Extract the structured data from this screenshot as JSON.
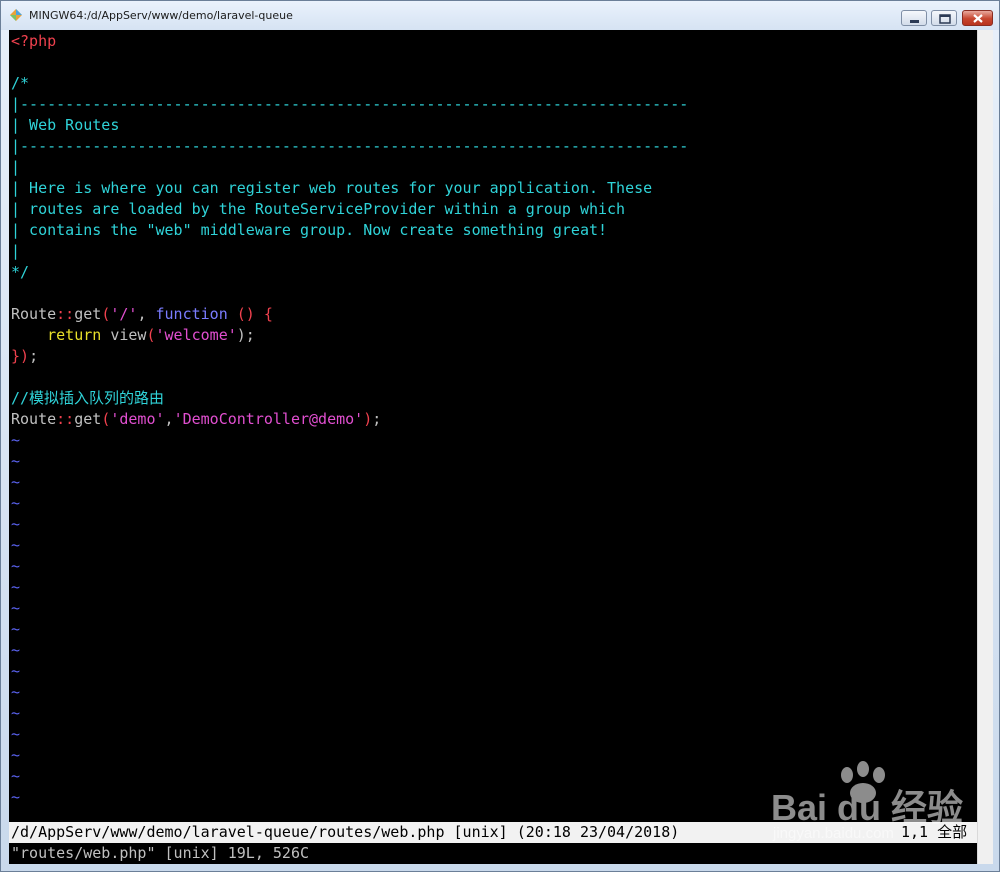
{
  "window": {
    "title": "MINGW64:/d/AppServ/www/demo/laravel-queue"
  },
  "colors": {
    "comment": "#2fd3d8",
    "red": "#f0414e",
    "string": "#e14fd0",
    "keyword": "#7a7cff",
    "plain": "#c0c0c0",
    "yellow": "#e8e02a",
    "tilde": "#5b63f2"
  },
  "editor": {
    "lines": [
      [
        {
          "t": "<?php",
          "c": "red"
        }
      ],
      [],
      [
        {
          "t": "/*",
          "c": "comment"
        }
      ],
      [
        {
          "t": "|--------------------------------------------------------------------------",
          "c": "comment"
        }
      ],
      [
        {
          "t": "| Web Routes",
          "c": "comment"
        }
      ],
      [
        {
          "t": "|--------------------------------------------------------------------------",
          "c": "comment"
        }
      ],
      [
        {
          "t": "|",
          "c": "comment"
        }
      ],
      [
        {
          "t": "| Here is where you can register web routes for your application. These",
          "c": "comment"
        }
      ],
      [
        {
          "t": "| routes are loaded by the RouteServiceProvider within a group which",
          "c": "comment"
        }
      ],
      [
        {
          "t": "| contains the \"web\" middleware group. Now create something great!",
          "c": "comment"
        }
      ],
      [
        {
          "t": "|",
          "c": "comment"
        }
      ],
      [
        {
          "t": "*/",
          "c": "comment"
        }
      ],
      [],
      [
        {
          "t": "Route",
          "c": "plain"
        },
        {
          "t": "::",
          "c": "red"
        },
        {
          "t": "get",
          "c": "plain"
        },
        {
          "t": "(",
          "c": "red"
        },
        {
          "t": "'/'",
          "c": "string"
        },
        {
          "t": ", ",
          "c": "plain"
        },
        {
          "t": "function",
          "c": "keyword"
        },
        {
          "t": " () {",
          "c": "red"
        }
      ],
      [
        {
          "t": "    ",
          "c": "plain"
        },
        {
          "t": "return",
          "c": "yellow"
        },
        {
          "t": " view",
          "c": "plain"
        },
        {
          "t": "(",
          "c": "red"
        },
        {
          "t": "'welcome'",
          "c": "string"
        },
        {
          "t": ");",
          "c": "plain"
        }
      ],
      [
        {
          "t": "})",
          "c": "red"
        },
        {
          "t": ";",
          "c": "plain"
        }
      ],
      [],
      [
        {
          "t": "//模拟插入队列的路由",
          "c": "comment"
        }
      ],
      [
        {
          "t": "Route",
          "c": "plain"
        },
        {
          "t": "::",
          "c": "red"
        },
        {
          "t": "get",
          "c": "plain"
        },
        {
          "t": "(",
          "c": "red"
        },
        {
          "t": "'demo'",
          "c": "string"
        },
        {
          "t": ",",
          "c": "plain"
        },
        {
          "t": "'DemoController@demo'",
          "c": "string"
        },
        {
          "t": ")",
          "c": "red"
        },
        {
          "t": ";",
          "c": "plain"
        }
      ]
    ],
    "tilde_char": "~",
    "tilde_count": 18
  },
  "statusbar": {
    "left": "/d/AppServ/www/demo/laravel-queue/routes/web.php [unix] (20:18 23/04/2018)",
    "right": "1,1 全部"
  },
  "message": "\"routes/web.php\" [unix] 19L, 526C",
  "watermark": {
    "brand": "Bai du 经验",
    "sub": "jingyan.baidu.com"
  }
}
